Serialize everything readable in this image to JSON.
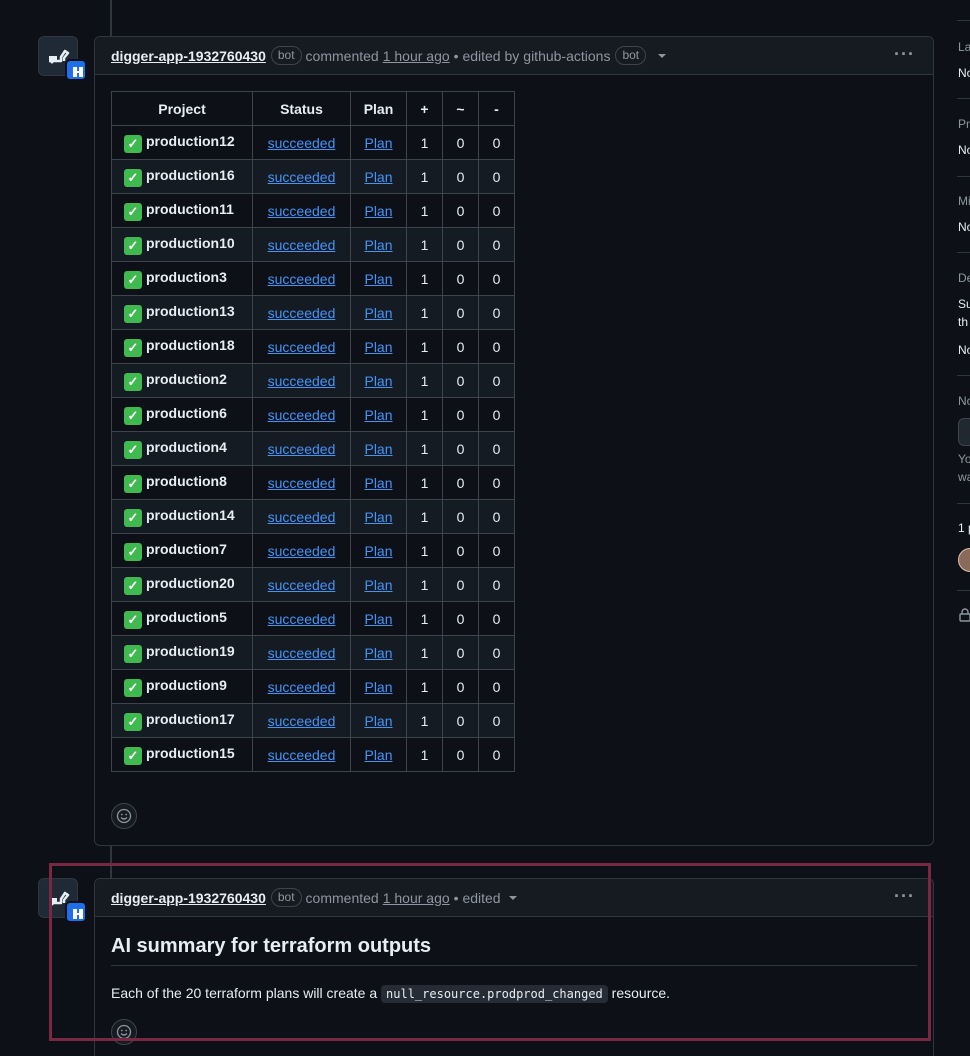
{
  "comment1": {
    "author": "digger-app-1932760430",
    "bot_label": "bot",
    "action": "commented",
    "time": "1 hour ago",
    "edited_prefix": "• edited by",
    "editor": "github-actions",
    "editor_bot": "bot",
    "menu": "···",
    "table": {
      "headers": [
        "Project",
        "Status",
        "Plan",
        "+",
        "~",
        "-"
      ],
      "rows": [
        {
          "project": "production12",
          "status": "succeeded",
          "plan": "Plan",
          "add": "1",
          "change": "0",
          "destroy": "0"
        },
        {
          "project": "production16",
          "status": "succeeded",
          "plan": "Plan",
          "add": "1",
          "change": "0",
          "destroy": "0"
        },
        {
          "project": "production11",
          "status": "succeeded",
          "plan": "Plan",
          "add": "1",
          "change": "0",
          "destroy": "0"
        },
        {
          "project": "production10",
          "status": "succeeded",
          "plan": "Plan",
          "add": "1",
          "change": "0",
          "destroy": "0"
        },
        {
          "project": "production3",
          "status": "succeeded",
          "plan": "Plan",
          "add": "1",
          "change": "0",
          "destroy": "0"
        },
        {
          "project": "production13",
          "status": "succeeded",
          "plan": "Plan",
          "add": "1",
          "change": "0",
          "destroy": "0"
        },
        {
          "project": "production18",
          "status": "succeeded",
          "plan": "Plan",
          "add": "1",
          "change": "0",
          "destroy": "0"
        },
        {
          "project": "production2",
          "status": "succeeded",
          "plan": "Plan",
          "add": "1",
          "change": "0",
          "destroy": "0"
        },
        {
          "project": "production6",
          "status": "succeeded",
          "plan": "Plan",
          "add": "1",
          "change": "0",
          "destroy": "0"
        },
        {
          "project": "production4",
          "status": "succeeded",
          "plan": "Plan",
          "add": "1",
          "change": "0",
          "destroy": "0"
        },
        {
          "project": "production8",
          "status": "succeeded",
          "plan": "Plan",
          "add": "1",
          "change": "0",
          "destroy": "0"
        },
        {
          "project": "production14",
          "status": "succeeded",
          "plan": "Plan",
          "add": "1",
          "change": "0",
          "destroy": "0"
        },
        {
          "project": "production7",
          "status": "succeeded",
          "plan": "Plan",
          "add": "1",
          "change": "0",
          "destroy": "0"
        },
        {
          "project": "production20",
          "status": "succeeded",
          "plan": "Plan",
          "add": "1",
          "change": "0",
          "destroy": "0"
        },
        {
          "project": "production5",
          "status": "succeeded",
          "plan": "Plan",
          "add": "1",
          "change": "0",
          "destroy": "0"
        },
        {
          "project": "production19",
          "status": "succeeded",
          "plan": "Plan",
          "add": "1",
          "change": "0",
          "destroy": "0"
        },
        {
          "project": "production9",
          "status": "succeeded",
          "plan": "Plan",
          "add": "1",
          "change": "0",
          "destroy": "0"
        },
        {
          "project": "production17",
          "status": "succeeded",
          "plan": "Plan",
          "add": "1",
          "change": "0",
          "destroy": "0"
        },
        {
          "project": "production15",
          "status": "succeeded",
          "plan": "Plan",
          "add": "1",
          "change": "0",
          "destroy": "0"
        }
      ]
    }
  },
  "comment2": {
    "author": "digger-app-1932760430",
    "bot_label": "bot",
    "action": "commented",
    "time": "1 hour ago",
    "edited": "• edited",
    "menu": "···",
    "heading": "AI summary for terraform outputs",
    "text_before": "Each of the 20 terraform plans will create a",
    "code": "null_resource.prodprod_changed",
    "text_after": "resource."
  },
  "sidebar": {
    "labels_heading": "La",
    "labels_value": "No",
    "projects_heading": "Pr",
    "projects_value": "No",
    "milestone_heading": "Mi",
    "milestone_value": "No",
    "dev_heading": "De",
    "dev_line1": "Su",
    "dev_line2": "th",
    "dev_value": "No",
    "notif_heading": "No",
    "notif_line1": "Yo",
    "notif_line2": "wa",
    "participants": "1 p"
  },
  "icons": {
    "check": "white-check-mark-icon",
    "smiley": "smiley-icon",
    "menu": "kebab-horizontal-icon",
    "lock": "lock-icon"
  }
}
